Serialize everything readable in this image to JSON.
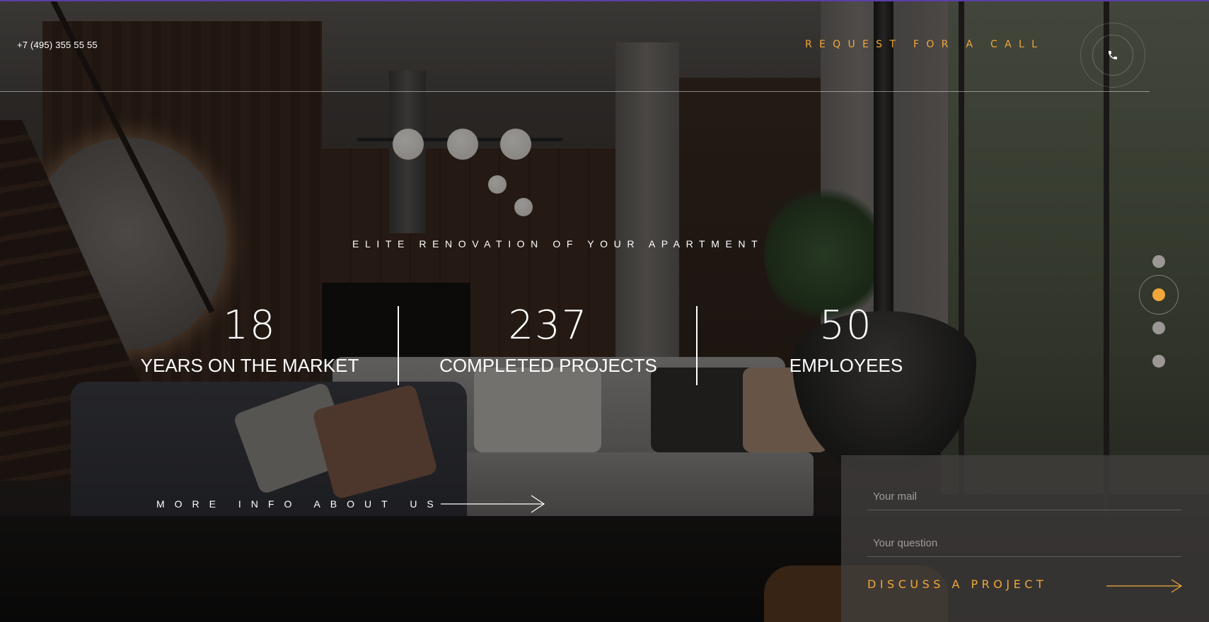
{
  "header": {
    "phone": "+7 (495) 355 55 55",
    "request_call": "REQUEST FOR A CALL",
    "call_icon": "phone-icon"
  },
  "hero": {
    "tagline": "ELITE RENOVATION OF YOUR APARTMENT",
    "stats": [
      {
        "number": "18",
        "label": "YEARS ON THE MARKET"
      },
      {
        "number": "237",
        "label": "COMPLETED PROJECTS"
      },
      {
        "number": "50",
        "label": "EMPLOYEES"
      }
    ],
    "more_info": "MORE INFO ABOUT US"
  },
  "slider": {
    "slides": 4,
    "active_index": 1
  },
  "form": {
    "mail_placeholder": "Your mail",
    "question_placeholder": "Your question",
    "submit_label": "DISCUSS A PROJECT"
  },
  "colors": {
    "accent": "#f1a73a",
    "text": "#ffffff",
    "panel": "#413f3d"
  }
}
